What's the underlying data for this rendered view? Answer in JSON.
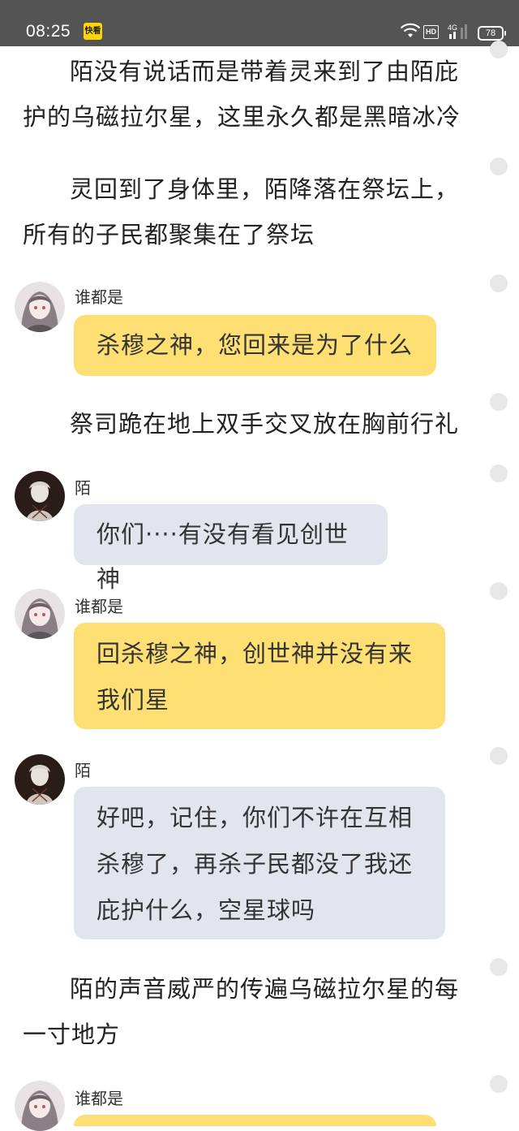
{
  "status_bar": {
    "time": "08:25",
    "app_badge": "快看",
    "hd_label": "HD",
    "network_label": "4G",
    "battery_level": "78"
  },
  "story": {
    "narration_1": "陌没有说话而是带着灵来到了由陌庇护的乌磁拉尔星，这里永久都是黑暗冰冷",
    "narration_2": "灵回到了身体里，陌降落在祭坛上，所有的子民都聚集在了祭坛",
    "msg_1": {
      "name": "谁都是",
      "text": "杀穆之神，您回来是为了什么"
    },
    "narration_3": "祭司跪在地上双手交叉放在胸前行礼",
    "msg_2": {
      "name": "陌",
      "text": "你们····有没有看见创世神"
    },
    "msg_3": {
      "name": "谁都是",
      "text": "回杀穆之神，创世神并没有来我们星"
    },
    "msg_4": {
      "name": "陌",
      "text": "好吧，记住，你们不许在互相杀穆了，再杀子民都没了我还庇护什么，空星球吗"
    },
    "narration_4": "陌的声音威严的传遍乌磁拉尔星的每一寸地方",
    "msg_5": {
      "name": "谁都是",
      "text": ""
    }
  },
  "colors": {
    "status_bar": "#545454",
    "bubble_yellow": "#fddf74",
    "bubble_gray": "#e1e6ee",
    "comment_dot": "#e7e7e7"
  },
  "icons": [
    "wifi-icon",
    "hd-icon",
    "signal-4g-icon",
    "battery-icon",
    "comment-dot-icon"
  ]
}
